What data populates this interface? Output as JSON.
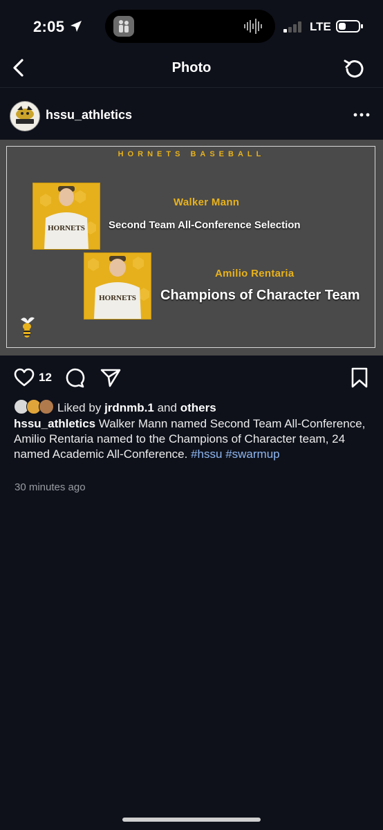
{
  "status_bar": {
    "time": "2:05",
    "carrier": "LTE"
  },
  "nav": {
    "title": "Photo",
    "back_icon": "chevron-left-icon",
    "refresh_icon": "refresh-icon"
  },
  "post": {
    "username": "hssu_athletics",
    "avatar_logo_text": "HORNETS",
    "image": {
      "heading": "HORNETS BASEBALL",
      "players": [
        {
          "name": "Walker Mann",
          "award": "Second Team All-Conference Selection"
        },
        {
          "name": "Amilio Rentaria",
          "award": "Champions of Character Team"
        }
      ],
      "accent_color": "#e8b21c",
      "background_color": "#4a4a4a"
    },
    "like_count": "12",
    "likes": {
      "prefix": "Liked by",
      "user": "jrdnmb.1",
      "conjunction": "and",
      "others": "others"
    },
    "caption": {
      "username": "hssu_athletics",
      "text": "Walker Mann named Second Team All-Conference, Amilio Rentaria named to the Champions of Character team, 24 named Academic All-Conference.",
      "hashtag_1": "#hssu",
      "hashtag_2": "#swarmup"
    },
    "timestamp": "30 minutes ago"
  },
  "colors": {
    "background": "#0e111a",
    "hashtag": "#8fb7f2"
  }
}
